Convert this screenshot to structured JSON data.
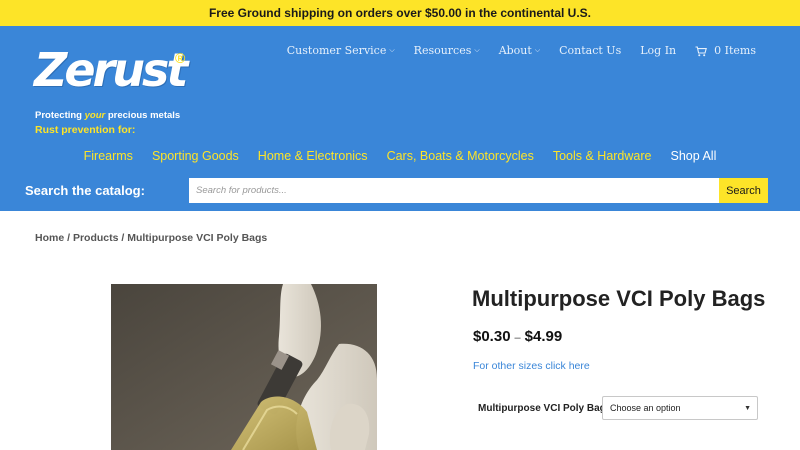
{
  "announcement": "Free Ground shipping on orders over $50.00 in the continental U.S.",
  "logo": {
    "word": "Zerust",
    "registered": "®",
    "tagline_pre": "Protecting ",
    "tagline_em": "your",
    "tagline_post": " precious metals"
  },
  "nav": {
    "customer_service": "Customer Service",
    "resources": "Resources",
    "about": "About",
    "contact": "Contact Us",
    "login": "Log In",
    "cart": "0 Items"
  },
  "rust_label": "Rust prevention for:",
  "categories": {
    "firearms": "Firearms",
    "sporting": "Sporting Goods",
    "home": "Home & Electronics",
    "vehicles": "Cars, Boats & Motorcycles",
    "tools": "Tools & Hardware",
    "shop_all": "Shop All"
  },
  "search": {
    "label": "Search the catalog:",
    "placeholder": "Search for products...",
    "button": "Search"
  },
  "breadcrumb": {
    "home": "Home",
    "products": "Products",
    "current": "Multipurpose VCI Poly Bags",
    "sep": " / "
  },
  "product": {
    "title": "Multipurpose VCI Poly Bags",
    "price_low": "$0.30",
    "price_dash": "–",
    "price_high": "$4.99",
    "sizes_link": "For other sizes click here",
    "option_label": "Multipurpose VCI Poly Bag",
    "option_value": "Choose an option"
  },
  "colors": {
    "header_blue": "#3a86d8",
    "accent_yellow": "#fde428"
  },
  "icons": {
    "cart": "shopping-cart-icon",
    "chevron": "chevron-down-icon"
  }
}
